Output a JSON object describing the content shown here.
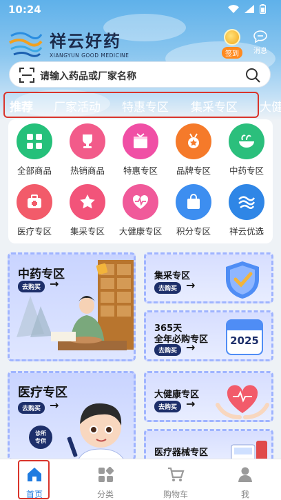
{
  "status": {
    "time": "10:24"
  },
  "header": {
    "brand_cn": "祥云好药",
    "brand_en": "XIANGYUN GOOD MEDICINE",
    "signin_label": "签到",
    "message_label": "消息"
  },
  "search": {
    "placeholder": "请输入药品或厂家名称"
  },
  "tabs": [
    {
      "label": "推荐"
    },
    {
      "label": "厂家活动"
    },
    {
      "label": "特惠专区"
    },
    {
      "label": "集采专区"
    },
    {
      "label": "大健"
    }
  ],
  "categories": [
    {
      "label": "全部商品",
      "color": "#25c07a",
      "icon": "grid-icon"
    },
    {
      "label": "热销商品",
      "color": "#f25b8a",
      "icon": "trophy-icon"
    },
    {
      "label": "特惠专区",
      "color": "#f04fa5",
      "icon": "gift-icon"
    },
    {
      "label": "品牌专区",
      "color": "#f57a2a",
      "icon": "medal-icon"
    },
    {
      "label": "中药专区",
      "color": "#2bbf7c",
      "icon": "herb-bowl-icon"
    },
    {
      "label": "医疗专区",
      "color": "#f25b6a",
      "icon": "medical-kit-icon"
    },
    {
      "label": "集采专区",
      "color": "#f2547a",
      "icon": "star-icon"
    },
    {
      "label": "大健康专区",
      "color": "#f05a9a",
      "icon": "heart-pulse-icon"
    },
    {
      "label": "积分专区",
      "color": "#3d8ef0",
      "icon": "shopping-bag-icon"
    },
    {
      "label": "祥云优选",
      "color": "#2f86e6",
      "icon": "cloud-wave-icon"
    }
  ],
  "promos": {
    "tcm": {
      "title": "中药专区",
      "button": "去购买"
    },
    "jicai": {
      "title": "集采专区",
      "button": "去购买"
    },
    "yearly": {
      "title_1": "365天",
      "title_2": "全年必购专区",
      "button": "去购买",
      "badge": "2025"
    },
    "medical": {
      "title": "医疗专区",
      "button": "去购买",
      "badge_1": "诊所",
      "badge_2": "专供"
    },
    "health": {
      "title": "大健康专区",
      "button": "去购买"
    },
    "device": {
      "title": "医疗器械专区"
    }
  },
  "tabbar": [
    {
      "label": "首页"
    },
    {
      "label": "分类"
    },
    {
      "label": "购物车"
    },
    {
      "label": "我"
    }
  ],
  "colors": {
    "accent": "#1f7be0",
    "highlight": "#d9342b"
  }
}
